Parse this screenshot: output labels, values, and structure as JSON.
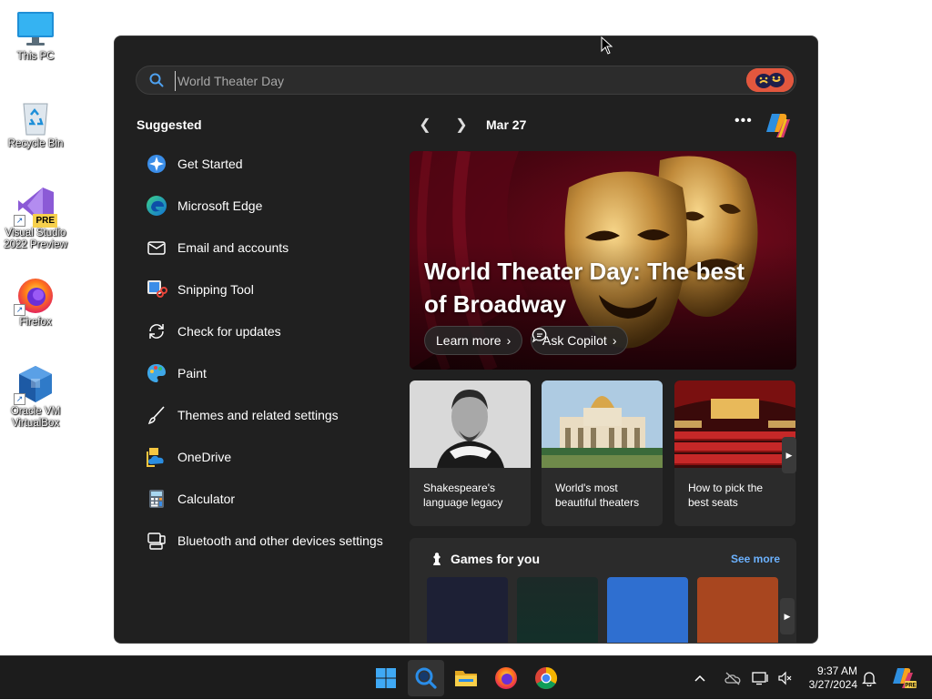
{
  "desktop": {
    "icons": [
      {
        "label": "This PC",
        "icon": "computer-icon"
      },
      {
        "label": "Recycle Bin",
        "icon": "recycle-bin-icon"
      },
      {
        "label": "Visual Studio 2022 Preview",
        "icon": "visual-studio-icon",
        "badge": "PRE"
      },
      {
        "label": "Firefox",
        "icon": "firefox-icon"
      },
      {
        "label": "Oracle VM VirtualBox",
        "icon": "virtualbox-icon"
      }
    ]
  },
  "search": {
    "placeholder": "World Theater Day",
    "value": ""
  },
  "suggested": {
    "title": "Suggested",
    "items": [
      {
        "label": "Get Started",
        "icon": "get-started-icon"
      },
      {
        "label": "Microsoft Edge",
        "icon": "edge-icon"
      },
      {
        "label": "Email and accounts",
        "icon": "mail-icon"
      },
      {
        "label": "Snipping Tool",
        "icon": "snipping-tool-icon"
      },
      {
        "label": "Check for updates",
        "icon": "sync-icon"
      },
      {
        "label": "Paint",
        "icon": "paint-icon"
      },
      {
        "label": "Themes and related settings",
        "icon": "brush-icon"
      },
      {
        "label": "OneDrive",
        "icon": "onedrive-icon"
      },
      {
        "label": "Calculator",
        "icon": "calculator-icon"
      },
      {
        "label": "Bluetooth and other devices settings",
        "icon": "devices-icon"
      }
    ]
  },
  "highlights": {
    "date": "Mar 27",
    "hero": {
      "title": "World Theater Day: The best of Broadway",
      "learn_more": "Learn more",
      "ask_copilot": "Ask Copilot"
    },
    "cards": [
      {
        "caption": "Shakespeare's language legacy"
      },
      {
        "caption": "World's most beautiful theaters"
      },
      {
        "caption": "How to pick the best seats"
      }
    ]
  },
  "games": {
    "title": "Games for you",
    "see_more": "See more",
    "tile_colors": [
      "#1d2035",
      "#1c2a28",
      "#2f6fd0",
      "#a8461f"
    ]
  },
  "taskbar": {
    "apps": [
      "start-icon",
      "search-icon",
      "file-explorer-icon",
      "firefox-icon",
      "chrome-icon"
    ],
    "time": "9:37 AM",
    "date": "3/27/2024"
  },
  "colors": {
    "panel_bg": "#202020",
    "accent_link": "#6cb2ff",
    "taskbar_bg": "#1c1c1c"
  }
}
